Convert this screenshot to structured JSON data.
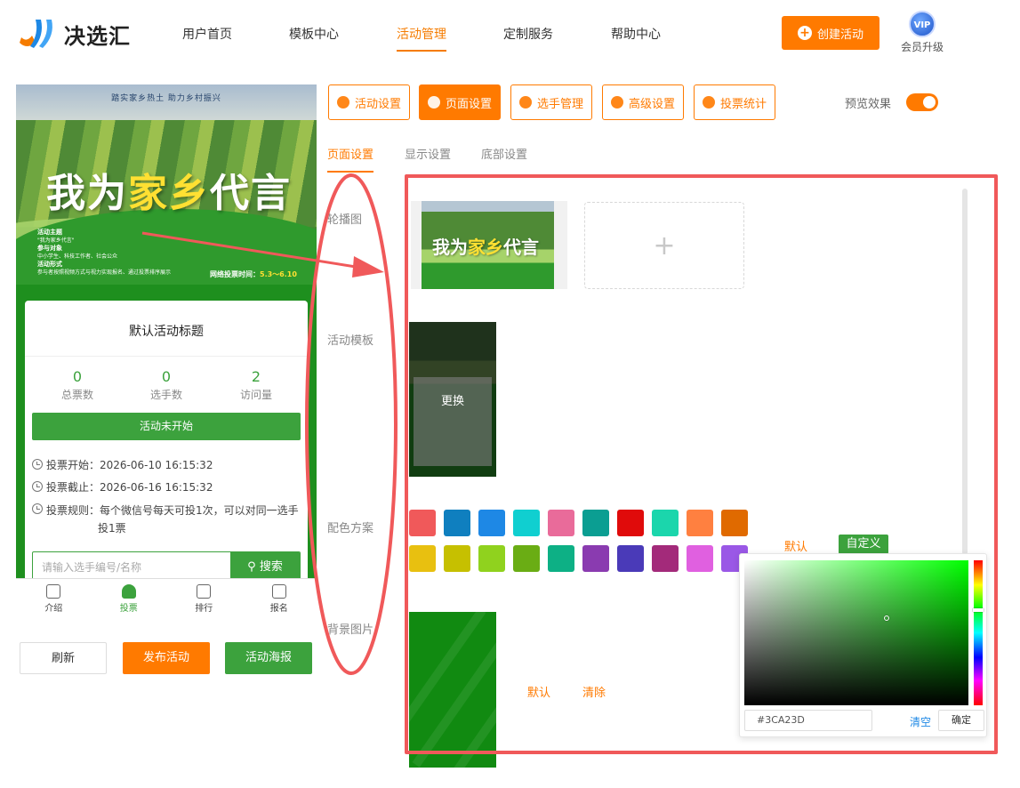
{
  "header": {
    "brand": "决选汇",
    "nav": [
      {
        "label": "用户首页"
      },
      {
        "label": "模板中心"
      },
      {
        "label": "活动管理",
        "active": true
      },
      {
        "label": "定制服务"
      },
      {
        "label": "帮助中心"
      }
    ],
    "create_label": "创建活动",
    "vip_badge": "VIP",
    "vip_label": "会员升级",
    "accent": "#ff7a00"
  },
  "preview": {
    "banner": {
      "slogan": "踏实家乡热土  助力乡村振兴",
      "title_part1": "我为",
      "title_part2": "家",
      "title_part3": "乡",
      "title_part4": "代言",
      "info": [
        "活动主题",
        "\"我为家乡代言\"",
        "参与对象",
        "中小学生、科技工作者、社会公众",
        "活动形式",
        "参与者按照视频方式与视力实现报名、通过投票排序展示"
      ],
      "period_label": "网络投票时间：",
      "period": "5.3～6.10"
    },
    "title": "默认活动标题",
    "stats": [
      {
        "value": "0",
        "label": "总票数"
      },
      {
        "value": "0",
        "label": "选手数"
      },
      {
        "value": "2",
        "label": "访问量"
      }
    ],
    "status": "活动未开始",
    "start": "投票开始：2026-06-10 16:15:32",
    "end": "投票截止：2026-06-16 16:15:32",
    "rule_line1": "投票规则：每个微信号每天可投1次，可以对同一选手",
    "rule_line2": "投1票",
    "search_placeholder": "请输入选手编号/名称",
    "search_label": "搜索",
    "tabbar": [
      {
        "label": "介绍"
      },
      {
        "label": "投票",
        "active": true
      },
      {
        "label": "排行"
      },
      {
        "label": "报名"
      }
    ],
    "btn_refresh": "刷新",
    "btn_publish": "发布活动",
    "btn_poster": "活动海报"
  },
  "settings": {
    "tabs": [
      {
        "label": "活动设置"
      },
      {
        "label": "页面设置",
        "active": true
      },
      {
        "label": "选手管理"
      },
      {
        "label": "高级设置"
      },
      {
        "label": "投票统计"
      }
    ],
    "preview_label": "预览效果",
    "preview_on": true,
    "subtabs": [
      {
        "label": "页面设置",
        "active": true
      },
      {
        "label": "显示设置"
      },
      {
        "label": "底部设置"
      }
    ],
    "rows": {
      "carousel": "轮播图",
      "template": "活动模板",
      "color": "配色方案",
      "bg": "背景图片"
    },
    "template_change": "更换",
    "swatches": [
      "#f0595a",
      "#0f7fbf",
      "#1e88e5",
      "#10cfd0",
      "#e96b9a",
      "#0b9e92",
      "#e00b0b",
      "#1bd6ac",
      "#ff8040",
      "#e06a00",
      "#e8c010",
      "#c6c000",
      "#90d21e",
      "#6aad14",
      "#0db085",
      "#8a3bb0",
      "#4a3ab8",
      "#a32a7a",
      "#e060e0",
      "#9a58e6"
    ],
    "color_default": "默认",
    "color_custom": "自定义",
    "bg_default": "默认",
    "bg_clear": "清除",
    "picker": {
      "hex": "#3CA23D",
      "clear": "清空",
      "confirm": "确定"
    }
  }
}
